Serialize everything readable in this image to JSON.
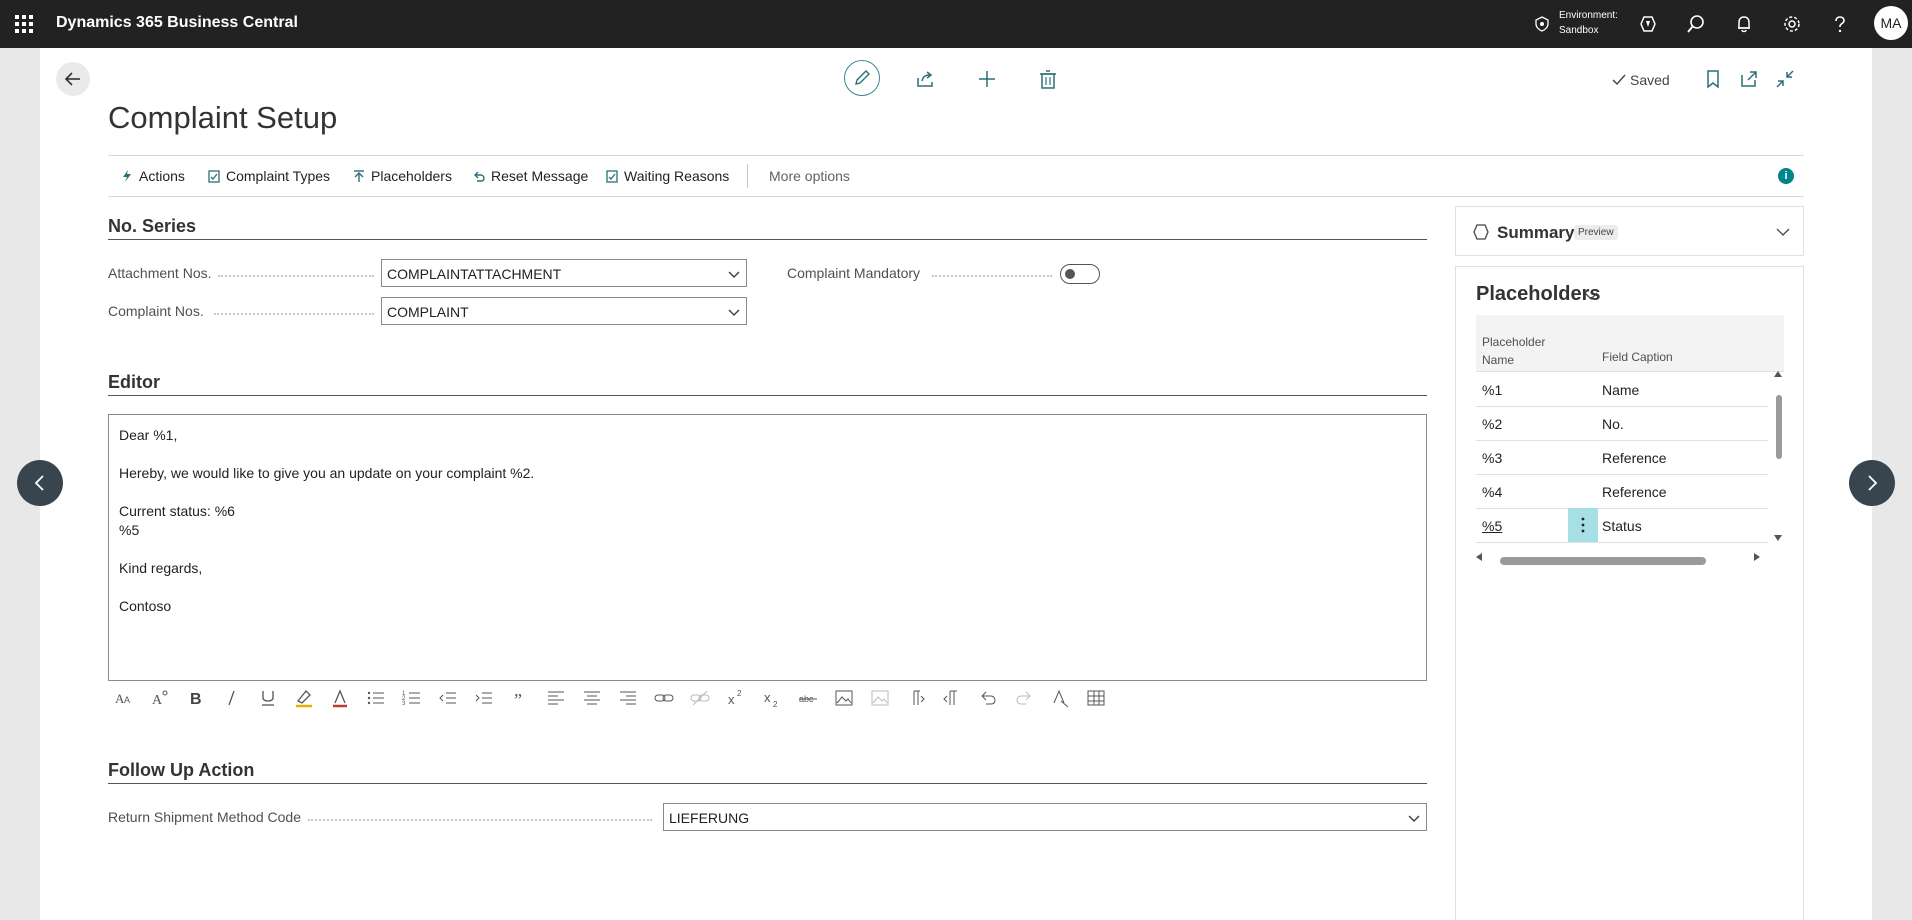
{
  "app": {
    "title": "Dynamics 365 Business Central",
    "environment_label": "Environment:",
    "environment_value": "Sandbox",
    "avatar_initials": "MA"
  },
  "page": {
    "title": "Complaint Setup",
    "saved_label": "Saved"
  },
  "actions": {
    "items": [
      {
        "label": "Actions",
        "icon": "lightning-icon"
      },
      {
        "label": "Complaint Types",
        "icon": "clipboard-check-icon"
      },
      {
        "label": "Placeholders",
        "icon": "pin-icon"
      },
      {
        "label": "Reset Message",
        "icon": "undo-icon"
      },
      {
        "label": "Waiting Reasons",
        "icon": "clipboard-check-icon"
      }
    ],
    "more": "More options"
  },
  "no_series": {
    "title": "No. Series",
    "attachment_label": "Attachment Nos.",
    "attachment_value": "COMPLAINTATTACHMENT",
    "complaint_label": "Complaint Nos.",
    "complaint_value": "COMPLAINT",
    "mandatory_label": "Complaint Mandatory",
    "mandatory_on": false
  },
  "editor": {
    "title": "Editor",
    "lines": [
      "Dear %1,",
      "Hereby, we would like to give you an update on your complaint %2.",
      "Current status: %6",
      "%5",
      "Kind regards,",
      "Contoso"
    ]
  },
  "follow_up": {
    "title": "Follow Up Action",
    "return_label": "Return Shipment Method Code",
    "return_value": "LIEFERUNG"
  },
  "factbox": {
    "summary_title": "Summary",
    "summary_badge": "Preview",
    "placeholders_title": "Placeholders",
    "col1": "Placeholder Name",
    "col2": "Field Caption",
    "rows": [
      {
        "name": "%1",
        "caption": "Name"
      },
      {
        "name": "%2",
        "caption": "No."
      },
      {
        "name": "%3",
        "caption": "Reference"
      },
      {
        "name": "%4",
        "caption": "Reference"
      },
      {
        "name": "%5",
        "caption": "Status"
      }
    ]
  },
  "colors": {
    "topbar": "#222222",
    "accent": "#008489",
    "selected_cell": "#a6dfe6"
  }
}
